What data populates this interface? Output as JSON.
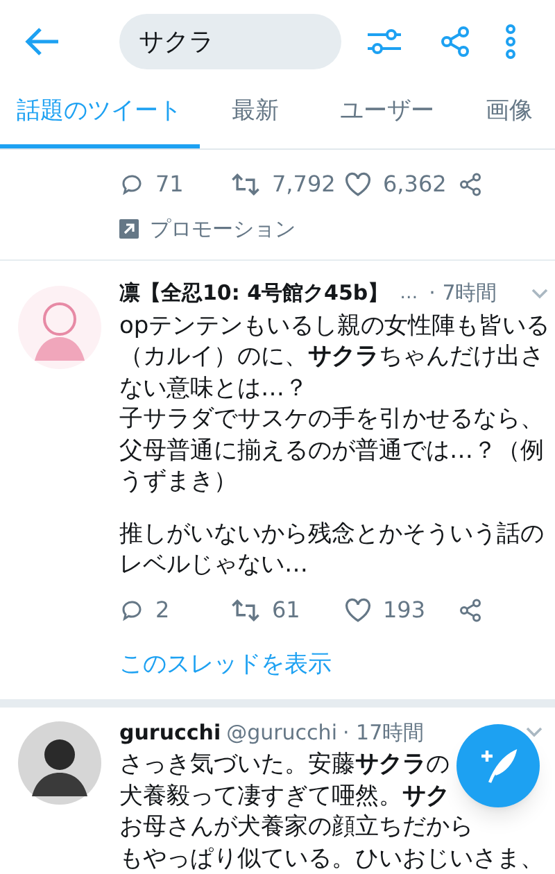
{
  "search": {
    "value": "サクラ"
  },
  "tabs": [
    {
      "label": "話題のツイート",
      "selected": true
    },
    {
      "label": "最新",
      "selected": false
    },
    {
      "label": "ユーザー",
      "selected": false
    },
    {
      "label": "画像",
      "selected": false
    }
  ],
  "tweets": [
    {
      "kind": "promoted",
      "replies": "71",
      "retweets": "7,792",
      "likes": "6,362",
      "promotion": "プロモーション"
    },
    {
      "kind": "thread",
      "name": "凛【全忍10: 4号館ク45b】",
      "more": "…",
      "time": "· 7時間",
      "paragraphs": [
        [
          "opテンテンもいるし親の女性陣も皆いる",
          "（カルイ）のに、**サクラ**ちゃんだけ出さ",
          "ない意味とは…？",
          "子サラダでサスケの手を引かせるなら、",
          "父母普通に揃えるのが普通では…？（例",
          "うずまき）"
        ],
        [
          "推しがいないから残念とかそういう話の",
          "レベルじゃない…"
        ]
      ],
      "replies": "2",
      "retweets": "61",
      "likes": "193",
      "thread_link": "このスレッドを表示"
    },
    {
      "kind": "plain",
      "name": "gurucchi",
      "handle": "@gurucchi",
      "time": "· 17時間",
      "paragraphs": [
        [
          "さっき気づいた。安藤**サクラ**の",
          "犬養毅って凄すぎて唖然。**サク**",
          "お母さんが犬養家の顔立ちだから",
          "もやっぱり似ている。ひいおじいさま、"
        ]
      ]
    }
  ]
}
